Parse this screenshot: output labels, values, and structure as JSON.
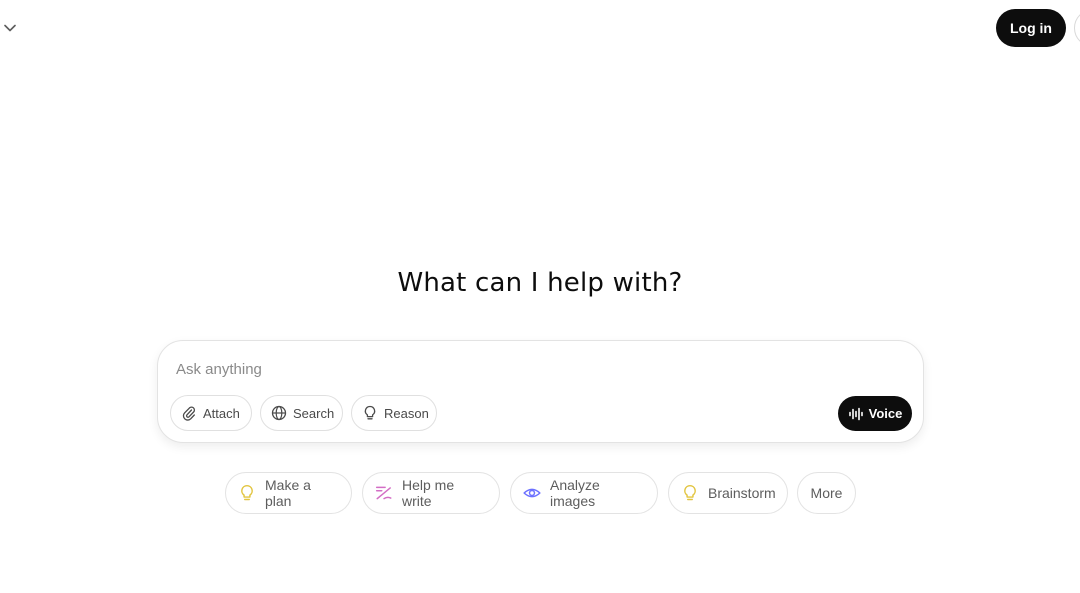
{
  "header": {
    "chevron_icon": "chevron-down-icon",
    "login_label": "Log in"
  },
  "main": {
    "headline": "What can I help with?"
  },
  "composer": {
    "placeholder": "Ask anything",
    "value": "",
    "tools": [
      {
        "label": "Attach",
        "icon": "paperclip-icon"
      },
      {
        "label": "Search",
        "icon": "globe-icon"
      },
      {
        "label": "Reason",
        "icon": "lightbulb-icon"
      }
    ],
    "voice": {
      "label": "Voice",
      "icon": "waveform-icon"
    }
  },
  "suggestions": [
    {
      "label": "Make a plan",
      "icon": "lightbulb-icon",
      "color": "#e2c541"
    },
    {
      "label": "Help me write",
      "icon": "pen-icon",
      "color": "#d36ec5"
    },
    {
      "label": "Analyze images",
      "icon": "eye-icon",
      "color": "#6c71ff"
    },
    {
      "label": "Brainstorm",
      "icon": "lightbulb-icon",
      "color": "#e2c541"
    },
    {
      "label": "More",
      "icon": "",
      "color": ""
    }
  ],
  "colors": {
    "primary": "#0d0d0d",
    "background": "#ffffff",
    "border": "#e3e3e3",
    "muted_text": "#5d5d5d"
  }
}
